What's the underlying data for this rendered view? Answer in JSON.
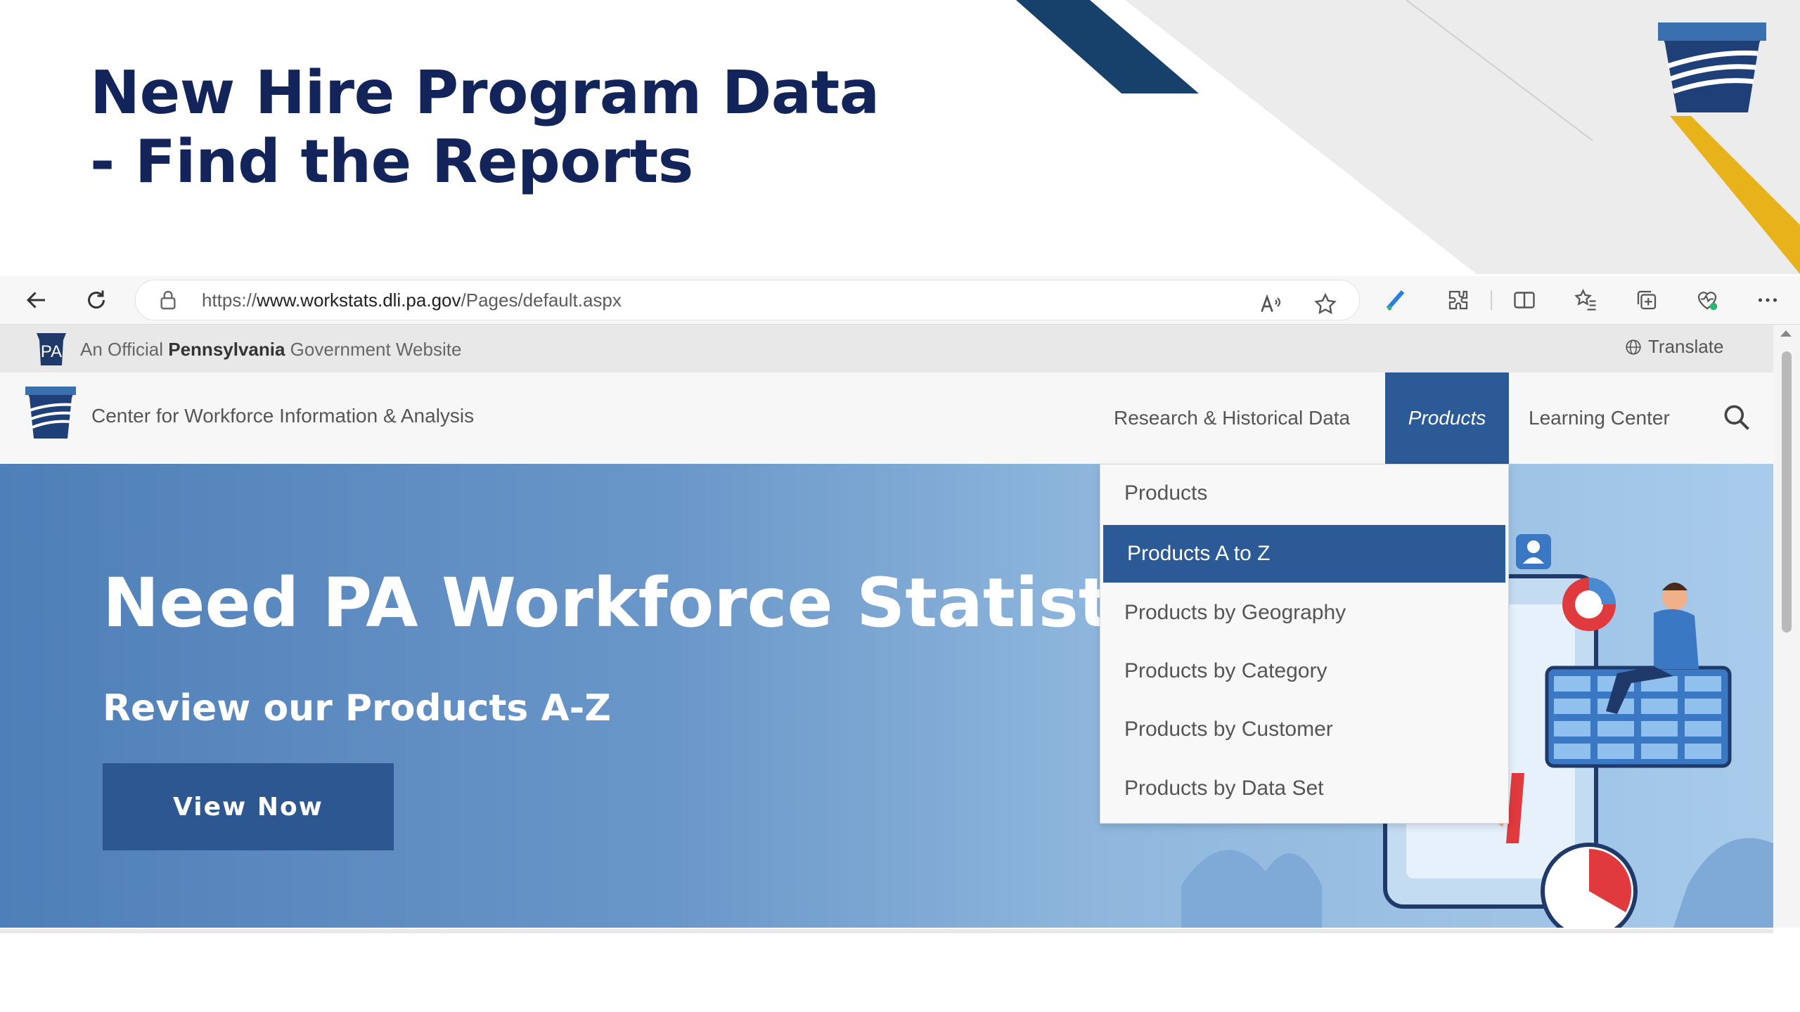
{
  "slide": {
    "title_line1": "New Hire Program Data",
    "title_line2": "- Find the Reports"
  },
  "browser": {
    "url_prefix": "https://",
    "url_domain": "www.workstats.dli.pa.gov",
    "url_path": "/Pages/default.aspx",
    "icons": [
      "back-icon",
      "refresh-icon",
      "lock-icon",
      "read-aloud-icon",
      "favorite-star-icon",
      "pen-extension-icon",
      "extensions-icon",
      "split-screen-icon",
      "favorites-icon",
      "collections-icon",
      "browser-essentials-icon",
      "more-icon"
    ]
  },
  "official_bar": {
    "prefix": "An Official ",
    "state": "Pennsylvania",
    "suffix": " Government Website",
    "badge": "PA",
    "translate": "Translate"
  },
  "header": {
    "site_name": "Center for Workforce Information & Analysis",
    "nav": [
      {
        "label": "Research & Historical Data"
      },
      {
        "label": "Products",
        "active": true
      },
      {
        "label": "Learning Center"
      }
    ]
  },
  "dropdown": {
    "items": [
      {
        "label": "Products"
      },
      {
        "label": "Products A to Z",
        "active": true
      },
      {
        "label": "Products by Geography"
      },
      {
        "label": "Products by Category"
      },
      {
        "label": "Products by Customer"
      },
      {
        "label": "Products by Data Set"
      }
    ]
  },
  "hero": {
    "title": "Need PA Workforce Statistics?",
    "subtitle": "Review our Products A-Z",
    "button": "View Now"
  },
  "colors": {
    "navy": "#12245a",
    "nav_active": "#2c5a96",
    "gold": "#e8b21a",
    "hero_start": "#4f7fb8",
    "hero_end": "#a8cbea"
  }
}
